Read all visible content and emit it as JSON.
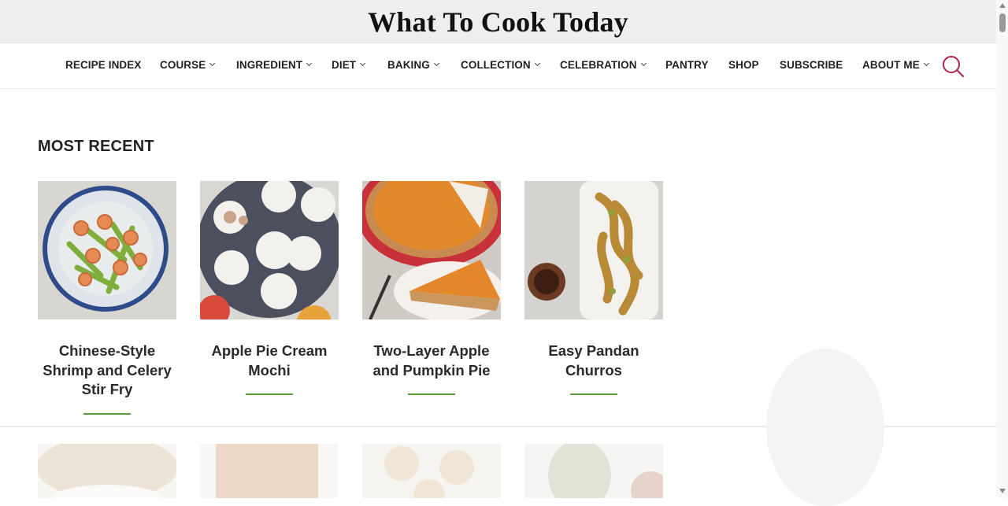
{
  "header": {
    "site_title": "What To Cook Today"
  },
  "nav": {
    "items": [
      {
        "label": "RECIPE INDEX",
        "has_dropdown": false
      },
      {
        "label": "COURSE",
        "has_dropdown": true
      },
      {
        "label": "INGREDIENT",
        "has_dropdown": true
      },
      {
        "label": "DIET",
        "has_dropdown": true
      },
      {
        "label": "BAKING",
        "has_dropdown": true
      },
      {
        "label": "COLLECTION",
        "has_dropdown": true
      },
      {
        "label": "CELEBRATION",
        "has_dropdown": true
      },
      {
        "label": "PANTRY",
        "has_dropdown": false
      },
      {
        "label": "SHOP",
        "has_dropdown": false
      },
      {
        "label": "SUBSCRIBE",
        "has_dropdown": false
      },
      {
        "label": "ABOUT ME",
        "has_dropdown": true
      }
    ],
    "search_icon": "search-icon",
    "search_color": "#b0254a"
  },
  "main": {
    "section_title": "MOST RECENT",
    "recipes": [
      {
        "title_lines": [
          "Chinese-Style",
          "Shrimp and Celery",
          "Stir Fry"
        ],
        "image": "shrimp-celery-stir-fry-photo"
      },
      {
        "title_lines": [
          "Apple Pie Cream",
          "Mochi"
        ],
        "image": "apple-pie-mochi-photo"
      },
      {
        "title_lines": [
          "Two-Layer Apple",
          "and Pumpkin Pie"
        ],
        "image": "pumpkin-pie-photo"
      },
      {
        "title_lines": [
          "Easy Pandan",
          "Churros"
        ],
        "image": "pandan-churros-photo"
      }
    ]
  },
  "colors": {
    "accent_underline": "#5a9e3a",
    "header_bg": "#eeeeee"
  }
}
